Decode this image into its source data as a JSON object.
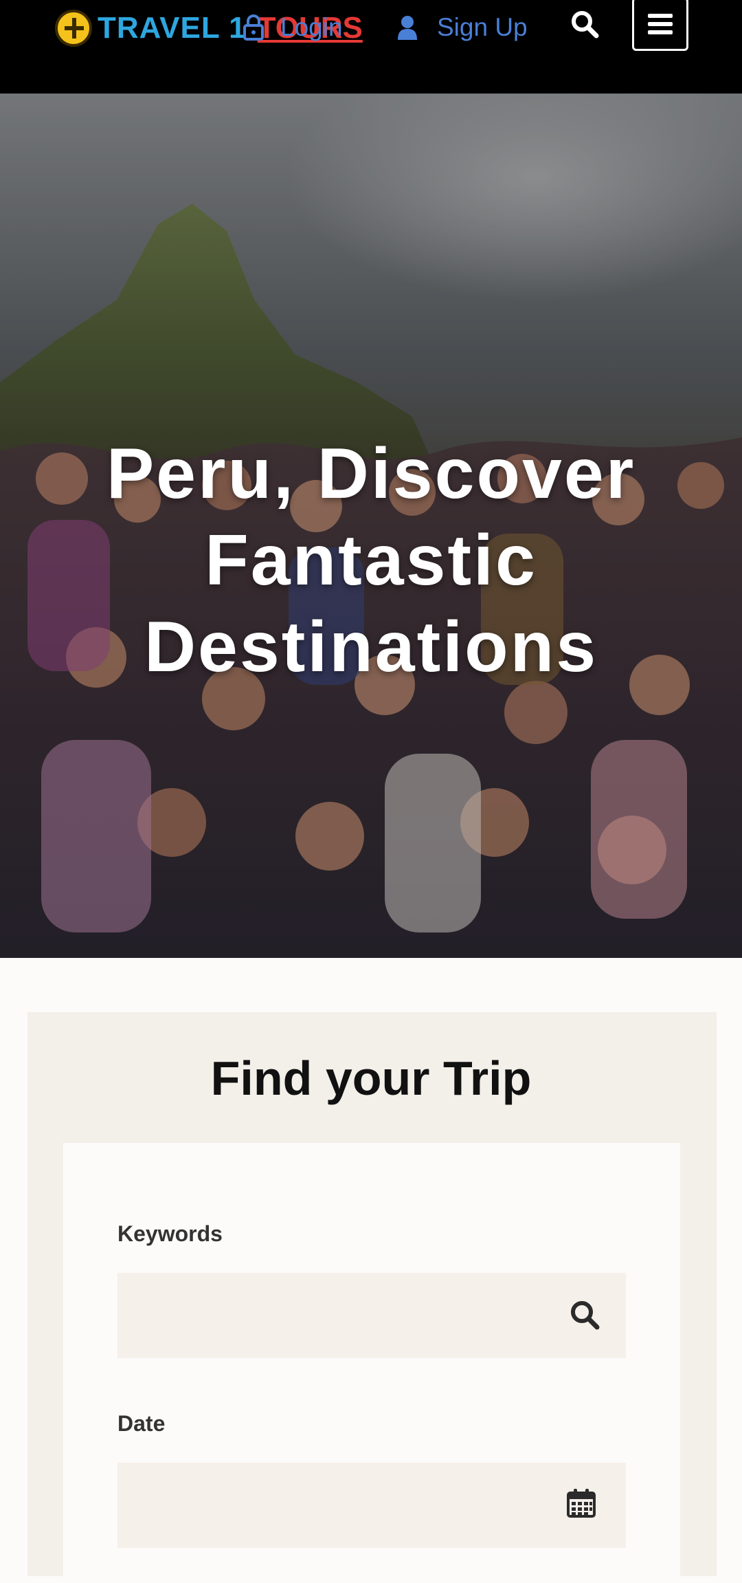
{
  "header": {
    "logo_text_1": "TRAVEL 1",
    "logo_text_2": "TOURS",
    "login_label": "Login",
    "signup_label": "Sign Up"
  },
  "hero": {
    "title_line_1": "Peru, Discover",
    "title_line_2": "Fantastic",
    "title_line_3": "Destinations"
  },
  "search": {
    "title": "Find your Trip",
    "keywords_label": "Keywords",
    "keywords_value": "",
    "date_label": "Date",
    "date_value": ""
  },
  "colors": {
    "header_bg": "#000000",
    "nav_link": "#4a7fd6",
    "panel_bg": "#f3efe9",
    "input_bg": "#f6f0ea"
  },
  "icons": [
    "logo-icon",
    "lock-icon",
    "user-icon",
    "search-icon",
    "menu-icon",
    "calendar-icon"
  ]
}
